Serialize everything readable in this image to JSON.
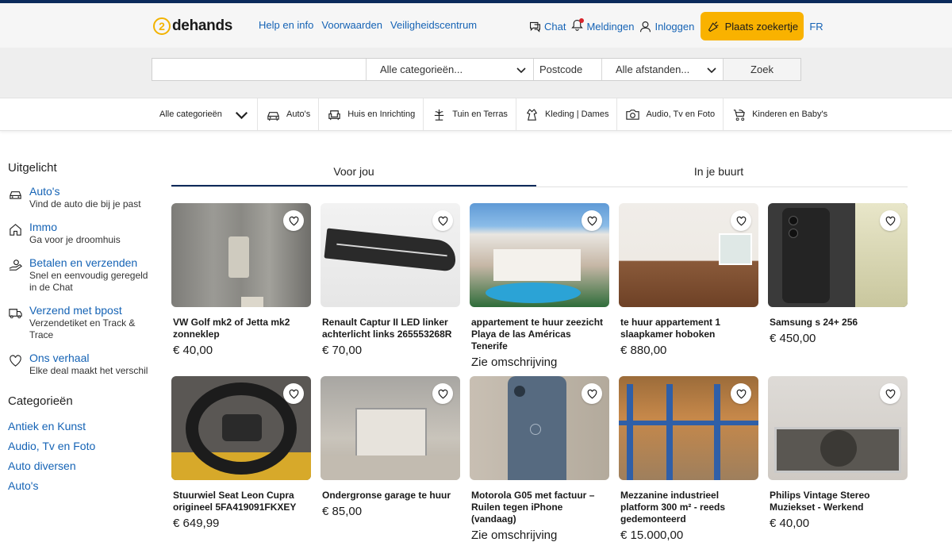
{
  "colors": {
    "brand_navy": "#0b2a5b",
    "link_blue": "#1563b5",
    "accent_yellow": "#f9b200"
  },
  "header": {
    "logo_num": "2",
    "logo_text": "dehands",
    "nav": [
      "Help en info",
      "Voorwaarden",
      "Veiligheidscentrum"
    ],
    "chat": "Chat",
    "notifications": "Meldingen",
    "login": "Inloggen",
    "post_button": "Plaats zoekertje",
    "lang": "FR"
  },
  "search": {
    "query_value": "",
    "category": "Alle categorieën...",
    "postcode_placeholder": "Postcode",
    "distance": "Alle afstanden...",
    "button": "Zoek"
  },
  "categories_bar": {
    "all": "Alle categorieën",
    "items": [
      {
        "label": "Auto's",
        "icon": "car-icon"
      },
      {
        "label": "Huis en Inrichting",
        "icon": "armchair-icon"
      },
      {
        "label": "Tuin en Terras",
        "icon": "garden-icon"
      },
      {
        "label": "Kleding | Dames",
        "icon": "clothing-icon"
      },
      {
        "label": "Audio, Tv en Foto",
        "icon": "camera-icon"
      },
      {
        "label": "Kinderen en Baby's",
        "icon": "stroller-icon"
      }
    ]
  },
  "sidebar": {
    "featured_title": "Uitgelicht",
    "featured": [
      {
        "title": "Auto's",
        "subtitle": "Vind de auto die bij je past",
        "icon": "car-icon"
      },
      {
        "title": "Immo",
        "subtitle": "Ga voor je droomhuis",
        "icon": "house-icon"
      },
      {
        "title": "Betalen en verzenden",
        "subtitle": "Snel en eenvoudig geregeld in de Chat",
        "icon": "payment-hand-icon"
      },
      {
        "title": "Verzend met bpost",
        "subtitle": "Verzendetiket en Track & Trace",
        "icon": "truck-icon"
      },
      {
        "title": "Ons verhaal",
        "subtitle": "Elke deal maakt het verschil",
        "icon": "heart-icon"
      }
    ],
    "categories_title": "Categorieën",
    "categories": [
      "Antiek en Kunst",
      "Audio, Tv en Foto",
      "Auto diversen",
      "Auto's"
    ]
  },
  "tabs": {
    "for_you": "Voor jou",
    "nearby": "In je buurt"
  },
  "listings": [
    {
      "title": "VW Golf mk2 of Jetta mk2 zonneklep",
      "price": "€ 40,00"
    },
    {
      "title": "Renault Captur II LED linker achterlicht links 265553268R",
      "price": "€ 70,00"
    },
    {
      "title": "appartement te huur zeezicht Playa de las Américas Tenerife",
      "price": "Zie omschrijving"
    },
    {
      "title": "te huur appartement 1 slaapkamer hoboken",
      "price": "€ 880,00"
    },
    {
      "title": "Samsung s 24+ 256",
      "price": "€ 450,00"
    },
    {
      "title": "Stuurwiel Seat Leon Cupra origineel 5FA419091FKXEY",
      "price": "€ 649,99"
    },
    {
      "title": "Ondergronse garage te huur",
      "price": "€ 85,00"
    },
    {
      "title": "Motorola G05 met factuur – Ruilen tegen iPhone (vandaag)",
      "price": "Zie omschrijving"
    },
    {
      "title": "Mezzanine industrieel platform 300 m² - reeds gedemonteerd",
      "price": "€ 15.000,00"
    },
    {
      "title": "Philips Vintage Stereo Muziekset - Werkend",
      "price": "€ 40,00"
    }
  ]
}
